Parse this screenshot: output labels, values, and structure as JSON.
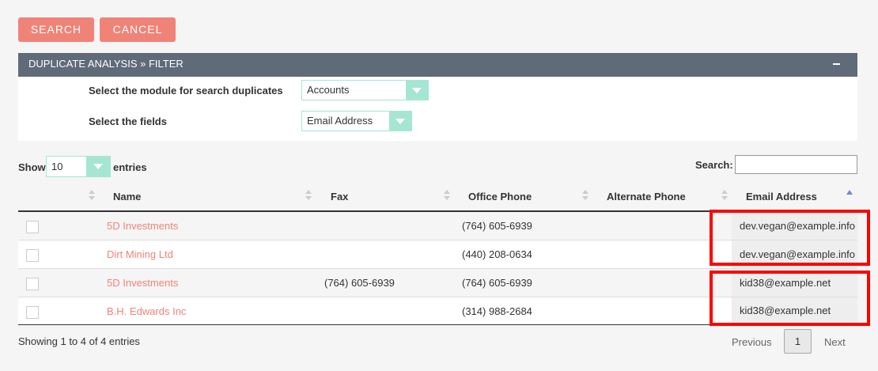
{
  "toolbar": {
    "search_label": "SEARCH",
    "cancel_label": "CANCEL"
  },
  "panel": {
    "title": "DUPLICATE ANALYSIS » FILTER",
    "module_label": "Select the module for search duplicates",
    "module_value": "Accounts",
    "fields_label": "Select the fields",
    "fields_value": "Email Address"
  },
  "list_controls": {
    "show_label": "Show",
    "show_value": "10",
    "entries_label": "entries",
    "search_label": "Search:",
    "search_value": ""
  },
  "table": {
    "columns": [
      "Name",
      "Fax",
      "Office Phone",
      "Alternate Phone",
      "Email Address"
    ],
    "rows": [
      {
        "name": "5D Investments",
        "fax": "",
        "office_phone": "(764) 605-6939",
        "alternate_phone": "",
        "email": "dev.vegan@example.info"
      },
      {
        "name": "Dirt Mining Ltd",
        "fax": "",
        "office_phone": "(440) 208-0634",
        "alternate_phone": "",
        "email": "dev.vegan@example.info"
      },
      {
        "name": "5D Investments",
        "fax": "(764) 605-6939",
        "office_phone": "(764) 605-6939",
        "alternate_phone": "",
        "email": "kid38@example.net"
      },
      {
        "name": "B.H. Edwards Inc",
        "fax": "",
        "office_phone": "(314) 988-2684",
        "alternate_phone": "",
        "email": "kid38@example.net"
      }
    ]
  },
  "footer": {
    "info": "Showing 1 to 4 of 4 entries",
    "previous_label": "Previous",
    "page": "1",
    "next_label": "Next"
  },
  "colors": {
    "accent": "#f08377",
    "panel_header": "#606b79",
    "select_accent": "#a5e6d2",
    "highlight": "#ff0000"
  }
}
